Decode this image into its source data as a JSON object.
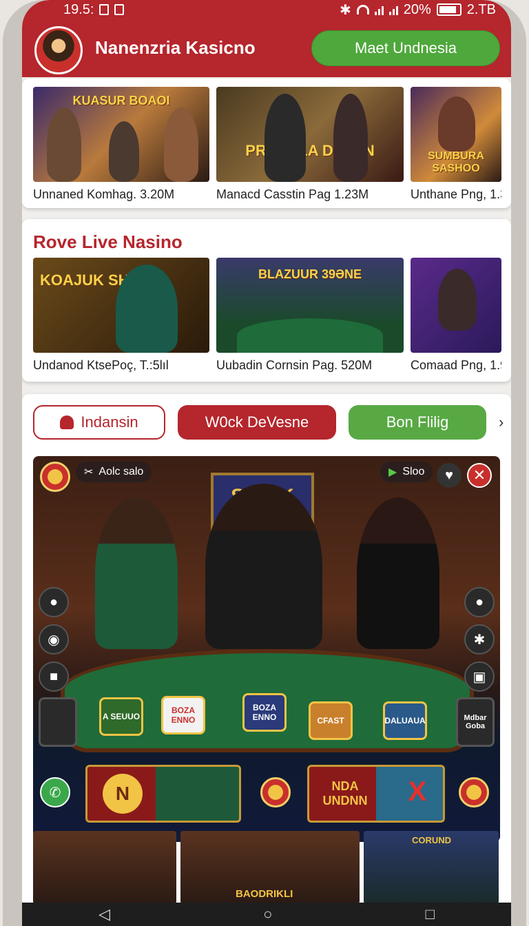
{
  "status": {
    "time": "19.5:",
    "battery": "20%",
    "data": "2.TB"
  },
  "header": {
    "brand": "Nanenzria Kasiсno",
    "meet_button": "Maet Undnesia"
  },
  "row1": {
    "items": [
      {
        "caption": "Unnaned Komhag. 3.20M",
        "banner": "KUASUR BOAOI"
      },
      {
        "caption": "Manacd Casstin Pag 1.23M",
        "banner": "PRASBLA DEJON"
      },
      {
        "caption": "Unthane Png, 1.3",
        "banner": "SUMBURA SASHOO"
      }
    ]
  },
  "live": {
    "title": "Rove Live Nasino",
    "items": [
      {
        "caption": "Undanod KtsePoç, T.:5lıl",
        "banner": "KOAJUK SHOAIN"
      },
      {
        "caption": "Uubadin Cornsin Pag. 520M",
        "banner": "BLAZUUR 39ƏNE"
      },
      {
        "caption": "Comaad Png, 1.9",
        "banner": ""
      }
    ]
  },
  "filters": {
    "outline": "Indansin",
    "red": "W0ck DeVesne",
    "green": "Bon Flilig"
  },
  "game": {
    "tag_left": "Aolc salo",
    "tag_right": "Sloo",
    "sign": "SPUIK",
    "chips": [
      "A SEUUO",
      "BOZA ENNO",
      "CFAST",
      "DALUAUA"
    ],
    "left_badge": "",
    "right_badge": "Mdbar Goba",
    "ctrl_left": "N",
    "ctrl_right": "NDA UNDNN",
    "ctrl_x": "X"
  },
  "bottom": {
    "label": "BAODRIKLI",
    "sign": "CORUND"
  },
  "colors": {
    "brand_red": "#b5262d",
    "green": "#4ea83b"
  }
}
